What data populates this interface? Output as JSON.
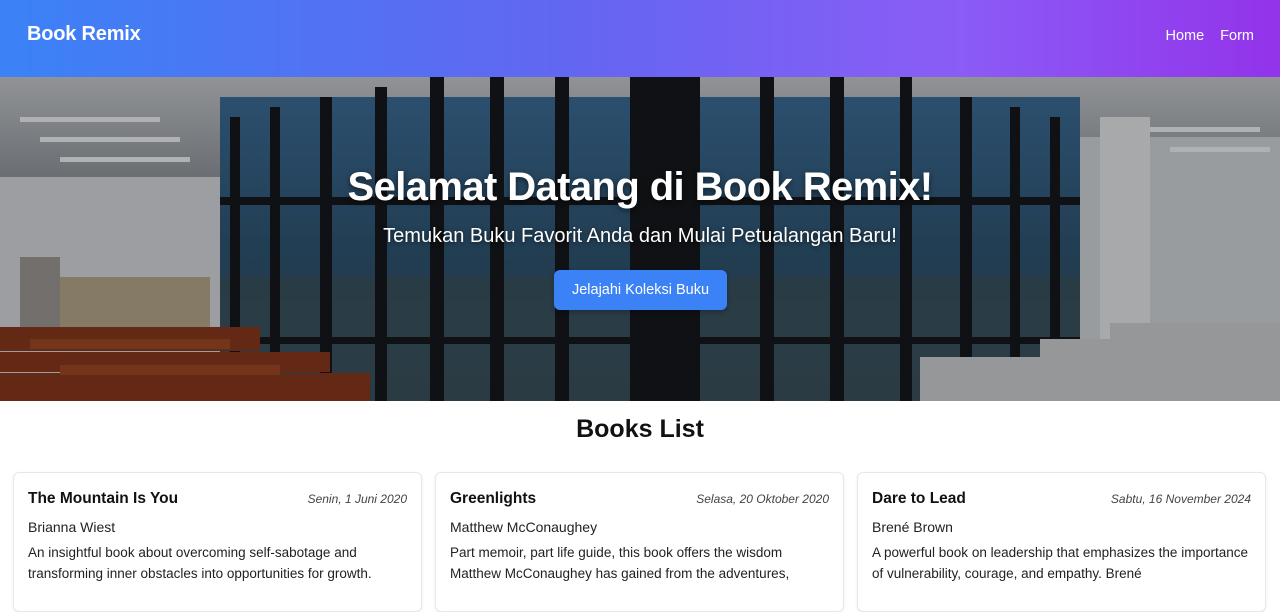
{
  "header": {
    "brand": "Book Remix",
    "nav": [
      {
        "label": "Home"
      },
      {
        "label": "Form"
      }
    ]
  },
  "hero": {
    "title": "Selamat Datang di Book Remix!",
    "subtitle": "Temukan Buku Favorit Anda dan Mulai Petualangan Baru!",
    "button_label": "Jelajahi Koleksi Buku",
    "background_icon": "library-interior-image"
  },
  "books": {
    "title": "Books List",
    "items": [
      {
        "title": "The Mountain Is You",
        "date": "Senin, 1 Juni 2020",
        "author": "Brianna Wiest",
        "description": "An insightful book about overcoming self-sabotage and transforming inner obstacles into opportunities for growth."
      },
      {
        "title": "Greenlights",
        "date": "Selasa, 20 Oktober 2020",
        "author": "Matthew McConaughey",
        "description": "Part memoir, part life guide, this book offers the wisdom Matthew McConaughey has gained from the adventures,"
      },
      {
        "title": "Dare to Lead",
        "date": "Sabtu, 16 November 2024",
        "author": "Brené Brown",
        "description": "A powerful book on leadership that emphasizes the importance of vulnerability, courage, and empathy. Brené"
      }
    ]
  },
  "colors": {
    "header_gradient_start": "#3b82f6",
    "header_gradient_end": "#9333ea",
    "button": "#3b82f6"
  }
}
